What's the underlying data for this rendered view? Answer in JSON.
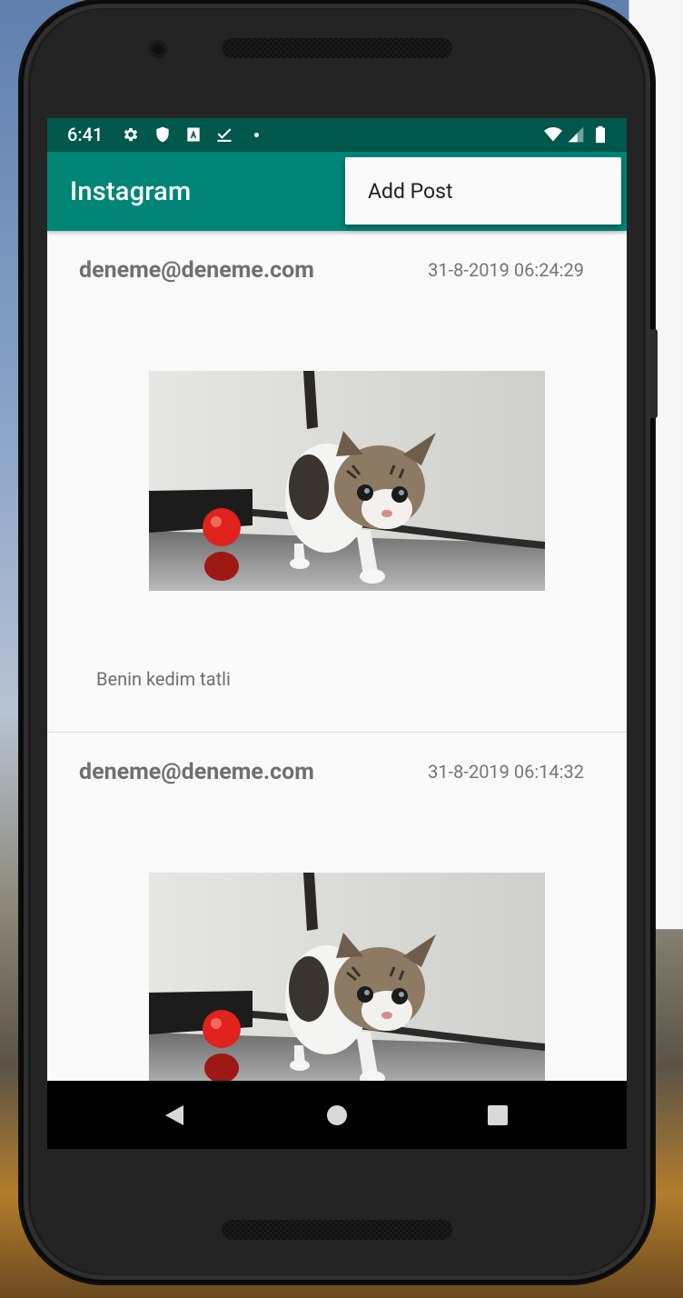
{
  "status_bar": {
    "time": "6:41",
    "icons": [
      "gear-icon",
      "shield-icon",
      "a-box-icon",
      "checkmark-icon",
      "wifi-icon",
      "signal-icon",
      "battery-icon"
    ]
  },
  "toolbar": {
    "title": "Instagram"
  },
  "overflow_menu": {
    "items": [
      {
        "label": "Add Post"
      }
    ]
  },
  "posts": [
    {
      "email": "deneme@deneme.com",
      "date": "31-8-2019 06:24:29",
      "image": "kitten-photo",
      "caption": "Benin kedim tatli"
    },
    {
      "email": "deneme@deneme.com",
      "date": "31-8-2019 06:14:32",
      "image": "kitten-photo",
      "caption": ""
    }
  ],
  "nav_bar": {
    "buttons": [
      "back-icon",
      "home-icon",
      "recents-icon"
    ]
  },
  "colors": {
    "status_bar": "#00574b",
    "toolbar": "#008577",
    "background": "#fafafa"
  }
}
